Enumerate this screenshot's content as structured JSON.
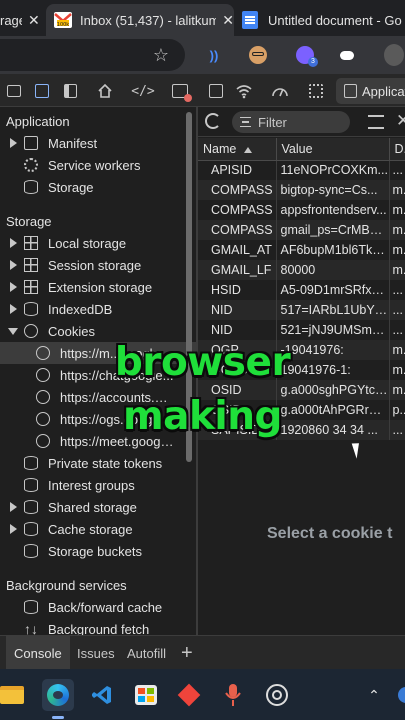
{
  "browser": {
    "tabs": [
      {
        "label": "rage",
        "close": "✕"
      },
      {
        "label": "Inbox (51,437) - lalitkum",
        "close": "✕"
      },
      {
        "label": "Untitled document - Go",
        "close": ""
      }
    ]
  },
  "devtools": {
    "active_panel": "Applicat"
  },
  "sidebar": {
    "sections": {
      "application": "Application",
      "storage": "Storage",
      "background": "Background services"
    },
    "application_items": [
      "Manifest",
      "Service workers",
      "Storage"
    ],
    "storage_items": [
      "Local storage",
      "Session storage",
      "Extension storage",
      "IndexedDB",
      "Cookies"
    ],
    "cookie_sites": [
      "https://m...ooogle...",
      "https://chatgoogle...",
      "https://accounts.go...",
      "https://ogs.google...",
      "https://meet.googl..."
    ],
    "more_items": [
      "Private state tokens",
      "Interest groups",
      "Shared storage",
      "Cache storage",
      "Storage buckets"
    ],
    "background_items": [
      "Back/forward cache",
      "Background fetch"
    ]
  },
  "cookies": {
    "filter_placeholder": "Filter",
    "columns": [
      "Name",
      "Value",
      "D..."
    ],
    "rows": [
      {
        "name": "APISID",
        "value": "11eNOPrCOXKm...",
        "domain": "..."
      },
      {
        "name": "COMPASS",
        "value": "bigtop-sync=Cs...",
        "domain": "m..."
      },
      {
        "name": "COMPASS",
        "value": "appsfrontendserv...",
        "domain": "m..."
      },
      {
        "name": "COMPASS",
        "value": "gmail_ps=CrMBA...",
        "domain": "m..."
      },
      {
        "name": "GMAIL_AT",
        "value": "AF6bupM1bl6TkC...",
        "domain": "m..."
      },
      {
        "name": "GMAIL_LF",
        "value": "80000",
        "domain": "m..."
      },
      {
        "name": "HSID",
        "value": "A5-09D1mrSRfx8...",
        "domain": "..."
      },
      {
        "name": "NID",
        "value": "517=IARbL1UbYP...",
        "domain": "..."
      },
      {
        "name": "NID",
        "value": "521=jNJ9UMSm7...",
        "domain": "..."
      },
      {
        "name": "OGP",
        "value": "-19041976:",
        "domain": "m..."
      },
      {
        "name": "OGPC",
        "value": "19041976-1:",
        "domain": "m..."
      },
      {
        "name": "OSID",
        "value": "g.a000sghPGYtcf...",
        "domain": "m..."
      },
      {
        "name": "OSID",
        "value": "g.a000tAhPGRrW...",
        "domain": "p..."
      },
      {
        "name": "SAPISID",
        "value": "1920860 34 34 ...",
        "domain": "..."
      }
    ],
    "select_message": "Select a cookie t"
  },
  "caption": {
    "line1": "browser",
    "line2": "making"
  },
  "drawer": {
    "tabs": [
      "Console",
      "Issues",
      "Autofill"
    ],
    "add": "+"
  },
  "colors": {
    "caption_green": "#1fdf3a",
    "devtools_bg": "#1f1f1f",
    "taskbar_bg": "#1c2633"
  }
}
